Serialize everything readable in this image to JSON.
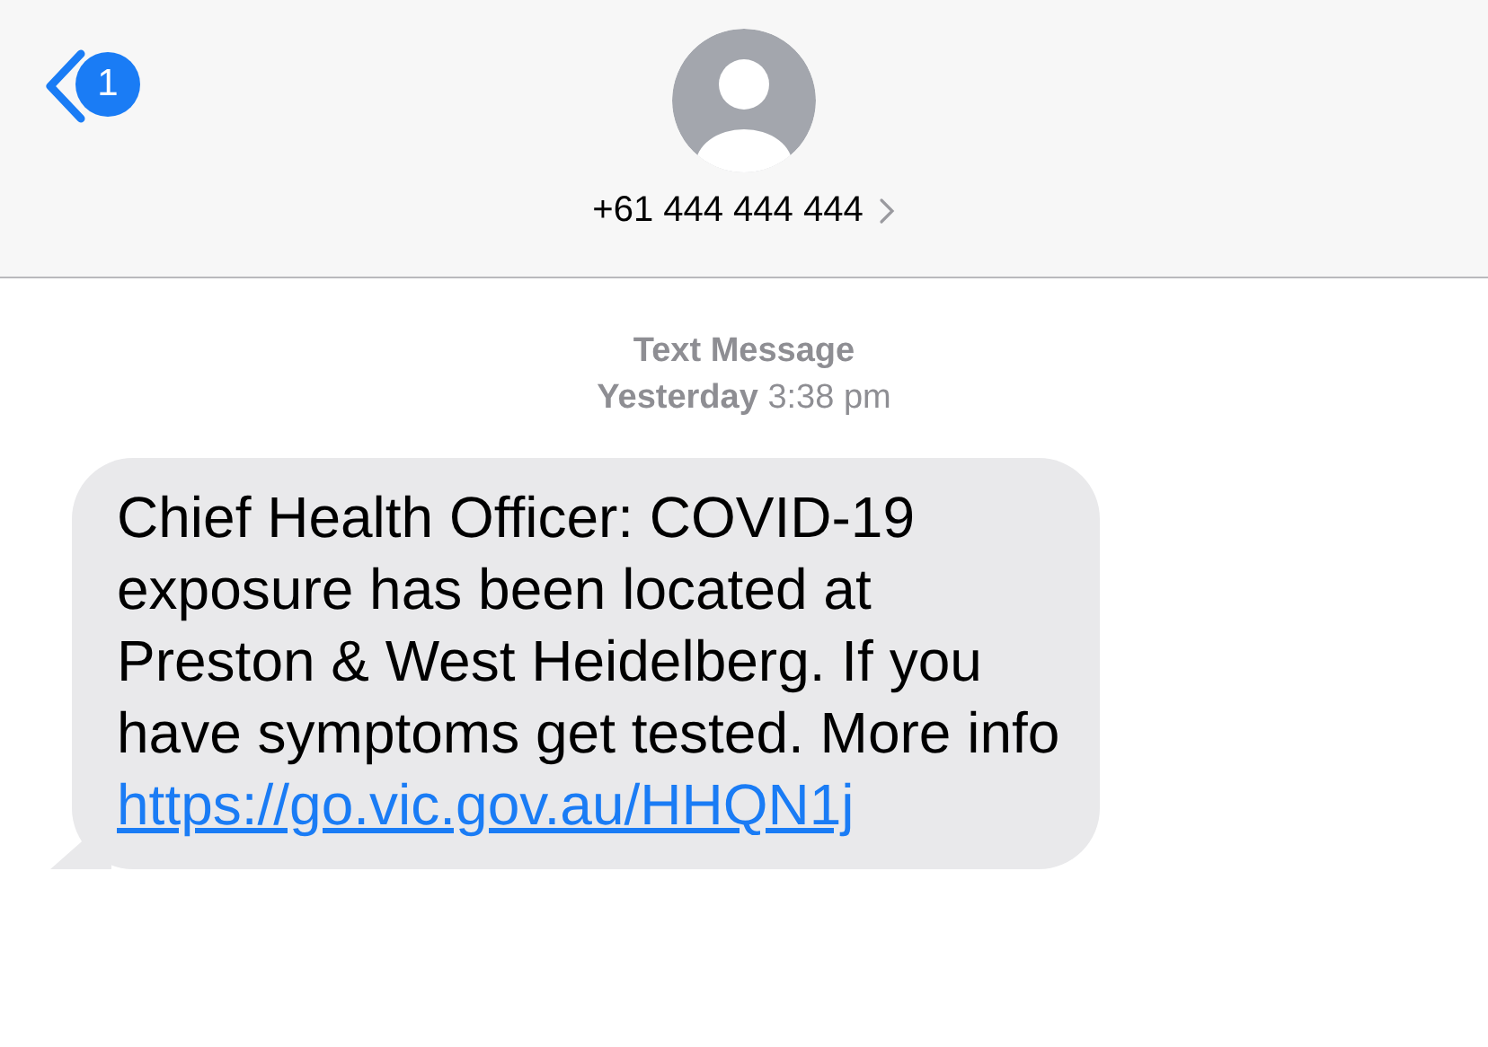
{
  "header": {
    "back_badge": "1",
    "contact": "+61 444 444 444"
  },
  "thread": {
    "service": "Text Message",
    "timestamp": "**Yesterday** 3:38 pm",
    "messages": [
      {
        "kind": "incoming",
        "text": "Chief Health Officer: COVID-19 exposure has been located at Preston & West Heidelberg. If you have symptoms get tested. More info ",
        "link": "https://go.vic.gov.au/HHQN1j"
      }
    ]
  }
}
